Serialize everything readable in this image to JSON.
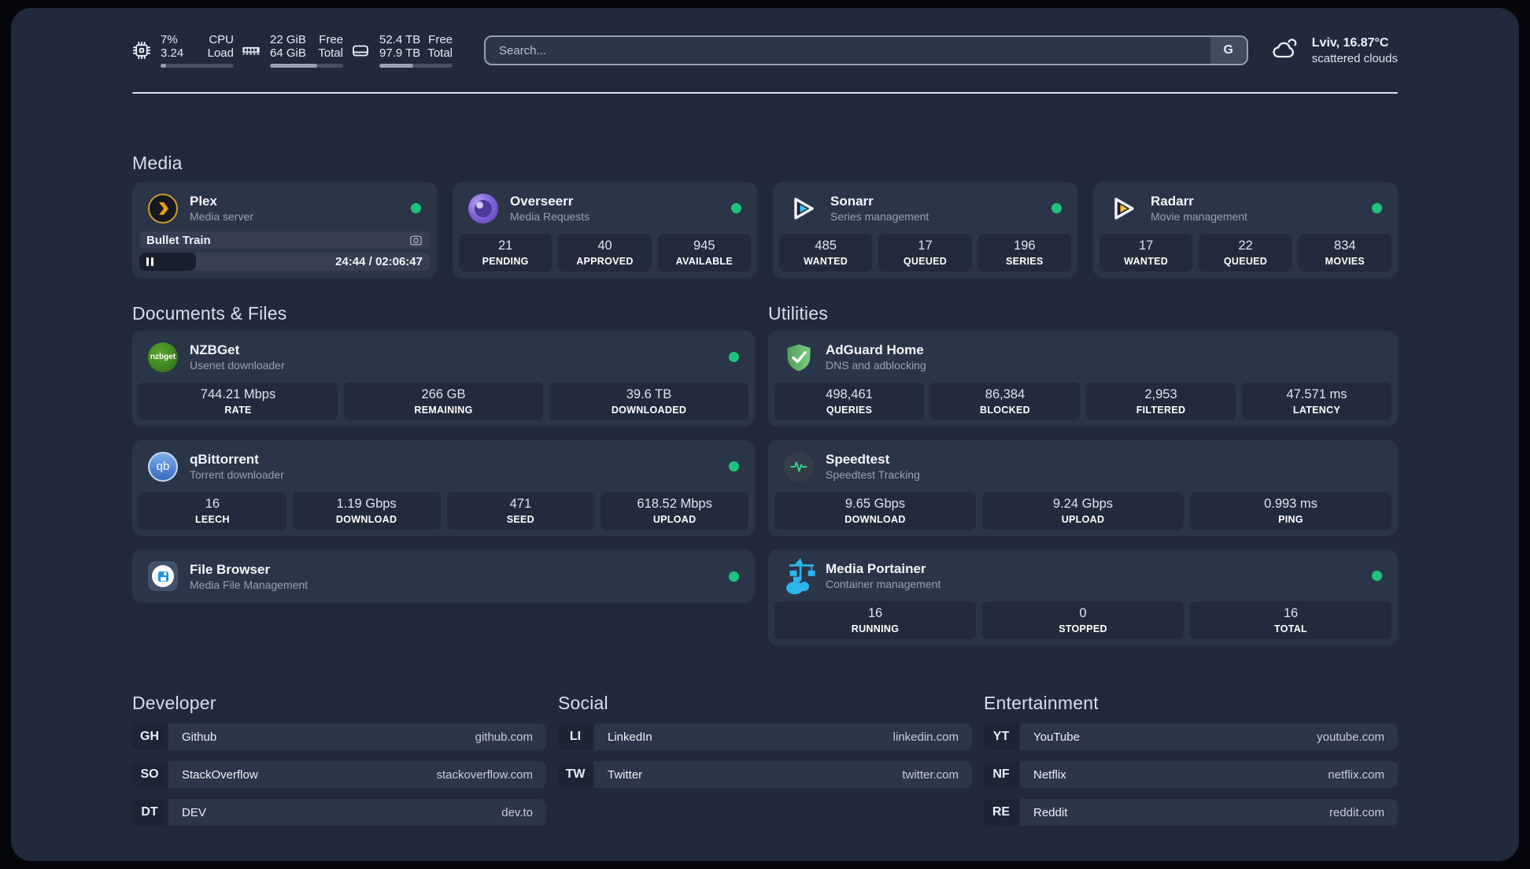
{
  "topbar": {
    "cpu": {
      "values": [
        "7%",
        "3.24"
      ],
      "labels": [
        "CPU",
        "Load"
      ],
      "progress": 7
    },
    "memory": {
      "values": [
        "22 GiB",
        "64 GiB"
      ],
      "labels": [
        "Free",
        "Total"
      ],
      "progress": 65
    },
    "disk": {
      "values": [
        "52.4 TB",
        "97.9 TB"
      ],
      "labels": [
        "Free",
        "Total"
      ],
      "progress": 46
    },
    "search": {
      "placeholder": "Search...",
      "button_label": "G"
    },
    "weather": {
      "location_temp": "Lviv, 16.87°C",
      "condition": "scattered clouds"
    }
  },
  "sections": {
    "media": {
      "title": "Media"
    },
    "documents": {
      "title": "Documents & Files"
    },
    "utilities": {
      "title": "Utilities"
    },
    "developer": {
      "title": "Developer"
    },
    "social": {
      "title": "Social"
    },
    "entertainment": {
      "title": "Entertainment"
    }
  },
  "apps": {
    "plex": {
      "name": "Plex",
      "desc": "Media server",
      "now_playing": {
        "title": "Bullet Train",
        "time": "24:44 / 02:06:47",
        "progress_pct": 19.5
      }
    },
    "overseerr": {
      "name": "Overseerr",
      "desc": "Media Requests",
      "stats": [
        {
          "value": "21",
          "label": "PENDING"
        },
        {
          "value": "40",
          "label": "APPROVED"
        },
        {
          "value": "945",
          "label": "AVAILABLE"
        }
      ]
    },
    "sonarr": {
      "name": "Sonarr",
      "desc": "Series management",
      "stats": [
        {
          "value": "485",
          "label": "WANTED"
        },
        {
          "value": "17",
          "label": "QUEUED"
        },
        {
          "value": "196",
          "label": "SERIES"
        }
      ]
    },
    "radarr": {
      "name": "Radarr",
      "desc": "Movie management",
      "stats": [
        {
          "value": "17",
          "label": "WANTED"
        },
        {
          "value": "22",
          "label": "QUEUED"
        },
        {
          "value": "834",
          "label": "MOVIES"
        }
      ]
    },
    "nzbget": {
      "name": "NZBGet",
      "desc": "Usenet downloader",
      "logo_text": "nzbget",
      "stats": [
        {
          "value": "744.21 Mbps",
          "label": "RATE"
        },
        {
          "value": "266 GB",
          "label": "REMAINING"
        },
        {
          "value": "39.6 TB",
          "label": "DOWNLOADED"
        }
      ]
    },
    "qbittorrent": {
      "name": "qBittorrent",
      "desc": "Torrent downloader",
      "logo_text": "qb",
      "stats": [
        {
          "value": "16",
          "label": "LEECH"
        },
        {
          "value": "1.19 Gbps",
          "label": "DOWNLOAD"
        },
        {
          "value": "471",
          "label": "SEED"
        },
        {
          "value": "618.52 Mbps",
          "label": "UPLOAD"
        }
      ]
    },
    "filebrowser": {
      "name": "File Browser",
      "desc": "Media File Management"
    },
    "adguard": {
      "name": "AdGuard Home",
      "desc": "DNS and adblocking",
      "stats": [
        {
          "value": "498,461",
          "label": "QUERIES"
        },
        {
          "value": "86,384",
          "label": "BLOCKED"
        },
        {
          "value": "2,953",
          "label": "FILTERED"
        },
        {
          "value": "47.571 ms",
          "label": "LATENCY"
        }
      ]
    },
    "speedtest": {
      "name": "Speedtest",
      "desc": "Speedtest Tracking",
      "stats": [
        {
          "value": "9.65 Gbps",
          "label": "DOWNLOAD"
        },
        {
          "value": "9.24 Gbps",
          "label": "UPLOAD"
        },
        {
          "value": "0.993 ms",
          "label": "PING"
        }
      ]
    },
    "portainer": {
      "name": "Media Portainer",
      "desc": "Container management",
      "stats": [
        {
          "value": "16",
          "label": "RUNNING"
        },
        {
          "value": "0",
          "label": "STOPPED"
        },
        {
          "value": "16",
          "label": "TOTAL"
        }
      ]
    }
  },
  "bookmarks": {
    "developer": [
      {
        "abbr": "GH",
        "name": "Github",
        "domain": "github.com"
      },
      {
        "abbr": "SO",
        "name": "StackOverflow",
        "domain": "stackoverflow.com"
      },
      {
        "abbr": "DT",
        "name": "DEV",
        "domain": "dev.to"
      }
    ],
    "social": [
      {
        "abbr": "LI",
        "name": "LinkedIn",
        "domain": "linkedin.com"
      },
      {
        "abbr": "TW",
        "name": "Twitter",
        "domain": "twitter.com"
      }
    ],
    "entertainment": [
      {
        "abbr": "YT",
        "name": "YouTube",
        "domain": "youtube.com"
      },
      {
        "abbr": "NF",
        "name": "Netflix",
        "domain": "netflix.com"
      },
      {
        "abbr": "RE",
        "name": "Reddit",
        "domain": "reddit.com"
      }
    ]
  },
  "colors": {
    "status_online": "#1dc47e",
    "accent_green": "#34d399",
    "portainer_blue": "#2cb5ea"
  }
}
